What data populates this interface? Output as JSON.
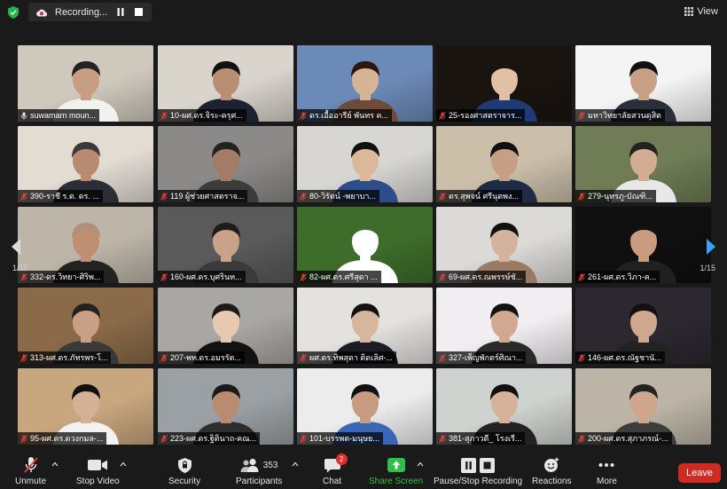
{
  "recording": {
    "label": "Recording..."
  },
  "view": {
    "label": "View"
  },
  "pager": {
    "left": "1/15",
    "right": "1/15"
  },
  "tiles": [
    {
      "name": "suwamarn moun...",
      "muted": false,
      "bg": "#cfc9bd",
      "skin": "#c79d83",
      "shirt": "#f1f1ef",
      "hair": "#222"
    },
    {
      "name": "10-ผศ.ดร.จิระ-ครุศ...",
      "muted": true,
      "bg": "#d9d4cc",
      "skin": "#b98e73",
      "shirt": "#1d2233",
      "hair": "#111"
    },
    {
      "name": "ดร.เอื้ออารีย์ พันทร ค...",
      "muted": true,
      "bg": "#6c8ab8",
      "skin": "#d8b497",
      "shirt": "#6e4a3a",
      "hair": "#2a1810"
    },
    {
      "name": "25-รองศาสตราจาร...",
      "muted": true,
      "bg": "#1a1410",
      "skin": "#e2c0a4",
      "shirt": "#1f3a75",
      "hair": "#1a1410"
    },
    {
      "name": "มหาวิทยาลัยสวนดุสิต",
      "muted": true,
      "bg": "#f4f4f4",
      "skin": "#c8a085",
      "shirt": "#2b2f3c",
      "hair": "#111"
    },
    {
      "name": "390-ราชี ร.ต. ดร. ...",
      "muted": true,
      "bg": "#e2dcd3",
      "skin": "#b88a70",
      "shirt": "#2a2d35",
      "hair": "#3a3a3a"
    },
    {
      "name": "119 ผู้ช่วยศาสตราจ...",
      "muted": true,
      "bg": "#8b8a88",
      "skin": "#a37c66",
      "shirt": "#3b3b3b",
      "hair": "#222"
    },
    {
      "name": "80-วิรัตน์ -พยาบา...",
      "muted": true,
      "bg": "#d8d6d2",
      "skin": "#dcb89b",
      "shirt": "#2d4c8a",
      "hair": "#111"
    },
    {
      "name": "ดร.สุพจน์ ศรีนุตพง...",
      "muted": true,
      "bg": "#cbbfaa",
      "skin": "#c79f85",
      "shirt": "#1f2a44",
      "hair": "#111"
    },
    {
      "name": "279-นุทรภู-บัณฑิ...",
      "muted": true,
      "bg": "#6f7c55",
      "skin": "#d3ad92",
      "shirt": "#e8e8e8",
      "hair": "#222"
    },
    {
      "name": "332-ดร.วิทยา-ศิริพ...",
      "muted": true,
      "bg": "#bdb5a8",
      "skin": "#c08f72",
      "shirt": "#222",
      "hair": "#b0907a"
    },
    {
      "name": "160-ผศ.ดร.บุศรินท...",
      "muted": true,
      "bg": "#5a5a5a",
      "skin": "#c9a289",
      "shirt": "#3a3a3a",
      "hair": "#1d1d1d"
    },
    {
      "name": "82-ผศ.ดร.ศรีสุดา ...",
      "muted": true,
      "bg": "#3e6d2b",
      "skin": "#ffffff",
      "shirt": "#ffffff",
      "hair": "#3e6d2b"
    },
    {
      "name": "69-ผศ.ดร.ณพรรษ์ชั...",
      "muted": true,
      "bg": "#dcdad6",
      "skin": "#d5b39b",
      "shirt": "#9a7a62",
      "hair": "#111"
    },
    {
      "name": "261-ผศ.ดร.วิภา-ค...",
      "muted": true,
      "bg": "#0f0f0f",
      "skin": "#c99c80",
      "shirt": "#202020",
      "hair": "#111"
    },
    {
      "name": "313-ผศ.ดร.ภัทรพร-โ...",
      "muted": true,
      "bg": "#8a6a48",
      "skin": "#c9a087",
      "shirt": "#3a3a3a",
      "hair": "#222"
    },
    {
      "name": "207-พท.ดร.อมรรัต...",
      "muted": true,
      "bg": "#a9a7a3",
      "skin": "#e7c8b0",
      "shirt": "#111",
      "hair": "#1a1a1a"
    },
    {
      "name": "ผศ.ดร.ทิพสุดา ติดเลิศ-...",
      "muted": true,
      "bg": "#e4e2df",
      "skin": "#d7b69d",
      "shirt": "#1c1c24",
      "hair": "#111"
    },
    {
      "name": "327-เพ็ญพักตร์ศิณา...",
      "muted": true,
      "bg": "#f0eef0",
      "skin": "#d2a990",
      "shirt": "#2a2a2a",
      "hair": "#111"
    },
    {
      "name": "146-ผศ.ดร.ณัฐชานั...",
      "muted": true,
      "bg": "#2c2830",
      "skin": "#cfa78d",
      "shirt": "#222",
      "hair": "#111"
    },
    {
      "name": "95-ผศ.ดร.ดวงกมล-...",
      "muted": true,
      "bg": "#c9a77e",
      "skin": "#d4b096",
      "shirt": "#f2f2f2",
      "hair": "#111"
    },
    {
      "name": "223-ผศ.ดร.ฐิตินาถ-คณ...",
      "muted": true,
      "bg": "#9aa0a4",
      "skin": "#b98c70",
      "shirt": "#2d2d2d",
      "hair": "#1a1a1a"
    },
    {
      "name": "101-บรรพต-มนุษย...",
      "muted": true,
      "bg": "#ececec",
      "skin": "#c69b7f",
      "shirt": "#3a66b8",
      "hair": "#111"
    },
    {
      "name": "381-สุภาวดี_ โรงเรี...",
      "muted": true,
      "bg": "#cfd3cf",
      "skin": "#d6b29a",
      "shirt": "#222",
      "hair": "#111"
    },
    {
      "name": "200-ผศ.ดร.สุภาภรณ์-...",
      "muted": true,
      "bg": "#bcb4a6",
      "skin": "#cfa68c",
      "shirt": "#3c3c3c",
      "hair": "#222"
    }
  ],
  "toolbar": {
    "unmute": "Unmute",
    "video": "Stop Video",
    "security": "Security",
    "participants": "Participants",
    "participants_count": "353",
    "chat": "Chat",
    "chat_badge": "2",
    "share": "Share Screen",
    "record": "Pause/Stop Recording",
    "reactions": "Reactions",
    "more": "More",
    "leave": "Leave"
  },
  "colors": {
    "accent_green": "#2fbf4a",
    "leave_red": "#cf2b25",
    "active_border": "#d7e64a",
    "muted_red": "#e0403a"
  }
}
